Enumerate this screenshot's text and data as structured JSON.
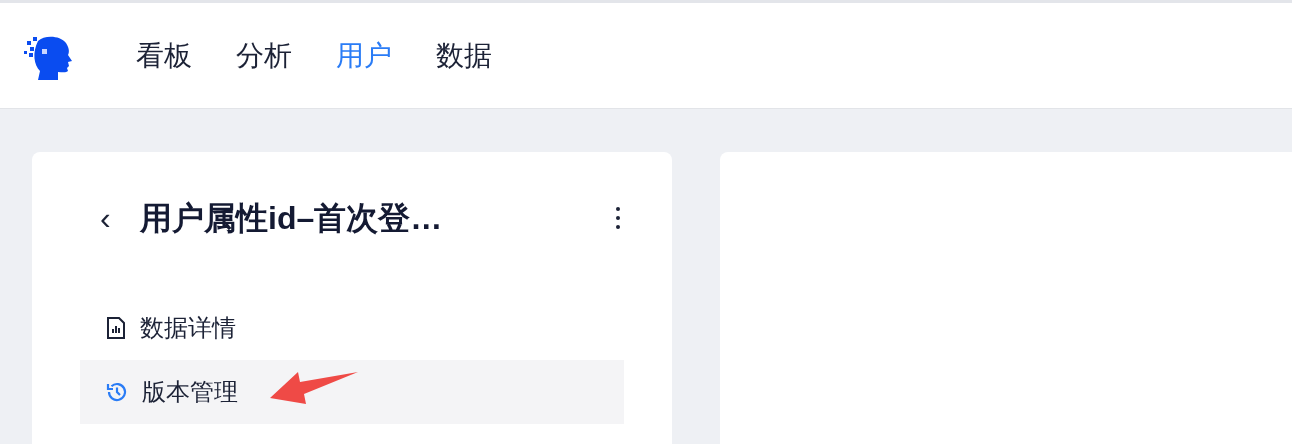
{
  "nav": {
    "items": [
      {
        "label": "看板",
        "selected": false
      },
      {
        "label": "分析",
        "selected": false
      },
      {
        "label": "用户",
        "selected": true
      },
      {
        "label": "数据",
        "selected": false
      }
    ]
  },
  "panel": {
    "back": "‹",
    "title": "用户属性id–首次登…",
    "menu": [
      {
        "kind": "report",
        "label": "数据详情",
        "selected": false
      },
      {
        "kind": "history",
        "label": "版本管理",
        "selected": true
      }
    ]
  }
}
